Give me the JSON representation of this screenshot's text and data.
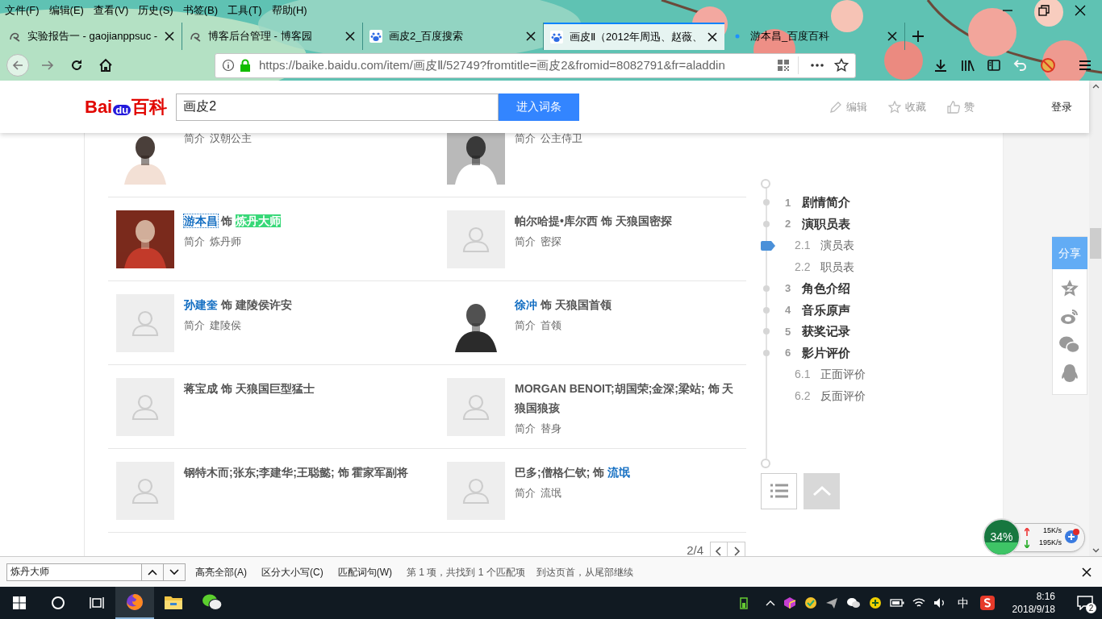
{
  "menu_bar": [
    "文件(F)",
    "编辑(E)",
    "查看(V)",
    "历史(S)",
    "书签(B)",
    "工具(T)",
    "帮助(H)"
  ],
  "tabs": [
    {
      "title": "实验报告一 - gaojianppsuc -",
      "kind": "swirl",
      "selected": false
    },
    {
      "title": "博客后台管理 - 博客园",
      "kind": "swirl",
      "selected": false
    },
    {
      "title": "画皮2_百度搜索",
      "kind": "paw",
      "selected": false
    },
    {
      "title": "画皮Ⅱ（2012年周迅、赵薇、",
      "kind": "paw",
      "selected": true
    },
    {
      "title": "游本昌_百度百科",
      "kind": "loading",
      "selected": false
    }
  ],
  "address_bar": {
    "url": "https://baike.baidu.com/item/画皮Ⅱ/52749?fromtitle=画皮2&fromid=8082791&fr=aladdin"
  },
  "page_header": {
    "logo": [
      "Bai",
      "du",
      "百科"
    ],
    "search_value": "画皮2",
    "search_button": "进入词条",
    "actions": [
      {
        "label": "编辑",
        "kind": "pencil"
      },
      {
        "label": "收藏",
        "kind": "star"
      },
      {
        "label": "赞",
        "kind": "thumb"
      }
    ],
    "login": "登录"
  },
  "cast": {
    "rows": [
      [
        {
          "intro_label": "简介",
          "intro": "汉朝公主",
          "kind": "picture"
        },
        {
          "intro_label": "简介",
          "intro": "公主侍卫",
          "kind": "picture"
        }
      ],
      [
        {
          "actor": "游本昌",
          "actor_link": true,
          "focused": true,
          "conj": "饰",
          "role": "炼丹大师",
          "role_link": false,
          "highlighted": true,
          "intro_label": "简介",
          "intro": "炼丹师",
          "kind": "picture"
        },
        {
          "actor": "帕尔哈提•库尔西",
          "actor_link": false,
          "focused": false,
          "conj": "饰",
          "role": "天狼国密探",
          "role_link": false,
          "highlighted": false,
          "intro_label": "简介",
          "intro": "密探",
          "kind": "placeholder"
        }
      ],
      [
        {
          "actor": "孙建奎",
          "actor_link": true,
          "focused": false,
          "conj": "饰",
          "role": "建陵侯许安",
          "role_link": false,
          "highlighted": false,
          "intro_label": "简介",
          "intro": "建陵侯",
          "kind": "placeholder"
        },
        {
          "actor": "徐冲",
          "actor_link": true,
          "focused": false,
          "conj": "饰",
          "role": "天狼国首领",
          "role_link": false,
          "highlighted": false,
          "intro_label": "简介",
          "intro": "首领",
          "kind": "picture"
        }
      ],
      [
        {
          "actor": "蒋宝成",
          "actor_link": false,
          "focused": false,
          "conj": "饰",
          "role": "天狼国巨型猛士",
          "role_link": false,
          "highlighted": false,
          "kind": "placeholder"
        },
        {
          "actor": "MORGAN BENOIT;胡国荣;金深;梁站;",
          "actor_link": false,
          "focused": false,
          "conj": "饰",
          "role": "天狼国狼孩",
          "role_link": false,
          "highlighted": false,
          "intro_label": "简介",
          "intro": "替身",
          "kind": "placeholder"
        }
      ],
      [
        {
          "actor": "钢特木而;张东;李建华;王聪懿;",
          "actor_link": false,
          "focused": false,
          "conj": "饰",
          "role": "霍家军副将",
          "role_link": false,
          "highlighted": false,
          "kind": "placeholder"
        },
        {
          "actor": "巴多;僧格仁钦;",
          "actor_link": false,
          "focused": false,
          "conj": "饰",
          "role": "流氓",
          "role_link": true,
          "highlighted": false,
          "intro_label": "简介",
          "intro": "流氓",
          "kind": "placeholder"
        }
      ]
    ],
    "pager": "2/4"
  },
  "toc": [
    {
      "number": "1",
      "title": "剧情简介",
      "selected": false
    },
    {
      "number": "2",
      "title": "演职员表",
      "selected": false,
      "children": [
        {
          "number": "2.1",
          "title": "演员表",
          "selected": true
        },
        {
          "number": "2.2",
          "title": "职员表",
          "selected": false
        }
      ]
    },
    {
      "number": "3",
      "title": "角色介绍",
      "selected": false
    },
    {
      "number": "4",
      "title": "音乐原声",
      "selected": false
    },
    {
      "number": "5",
      "title": "获奖记录",
      "selected": false
    },
    {
      "number": "6",
      "title": "影片评价",
      "selected": false,
      "children": [
        {
          "number": "6.1",
          "title": "正面评价",
          "selected": false
        },
        {
          "number": "6.2",
          "title": "反面评价",
          "selected": false
        }
      ]
    }
  ],
  "share": {
    "label": "分享"
  },
  "network_monitor": {
    "percent": "34%",
    "upload": "15K/s",
    "download": "195K/s"
  },
  "find_bar": {
    "value": "炼丹大师",
    "options": [
      "高亮全部(A)",
      "区分大小写(C)",
      "匹配词句(W)"
    ],
    "result": "第 1 项，共找到 1 个匹配项",
    "notice": "到达页首，从尾部继续"
  },
  "taskbar": {
    "apps": [
      {
        "kind": "browser",
        "active": true
      },
      {
        "kind": "folder",
        "active": false
      },
      {
        "kind": "chat",
        "active": false
      }
    ],
    "ime": "中",
    "time": "8:16",
    "date": "2018/9/18",
    "notifications": "2"
  }
}
